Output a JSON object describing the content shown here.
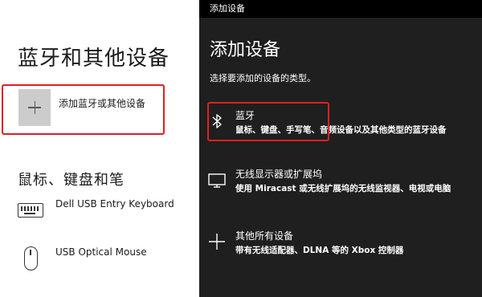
{
  "settings": {
    "title": "蓝牙和其他设备",
    "add_label": "添加蓝牙或其他设备",
    "section_title": "鼠标、键盘和笔",
    "devices": [
      {
        "name": "Dell USB Entry Keyboard",
        "icon": "keyboard-icon"
      },
      {
        "name": "USB Optical Mouse",
        "icon": "mouse-icon"
      }
    ]
  },
  "dialog": {
    "window_title": "添加设备",
    "heading": "添加设备",
    "subtitle": "选择要添加的设备的类型。",
    "options": [
      {
        "title": "蓝牙",
        "desc": "鼠标、键盘、手写笔、音频设备以及其他类型的蓝牙设备",
        "icon": "bluetooth-icon"
      },
      {
        "title": "无线显示器或扩展坞",
        "desc": "使用 Miracast 或无线扩展坞的无线监视器、电视或电脑",
        "icon": "monitor-icon"
      },
      {
        "title": "其他所有设备",
        "desc": "带有无线适配器、DLNA 等的 Xbox 控制器",
        "icon": "plus-icon"
      }
    ]
  },
  "colors": {
    "highlight": "#e02020",
    "panel_bg": "#1f1f1f",
    "titlebar_bg": "#000000",
    "plus_tile": "#cccccc"
  }
}
